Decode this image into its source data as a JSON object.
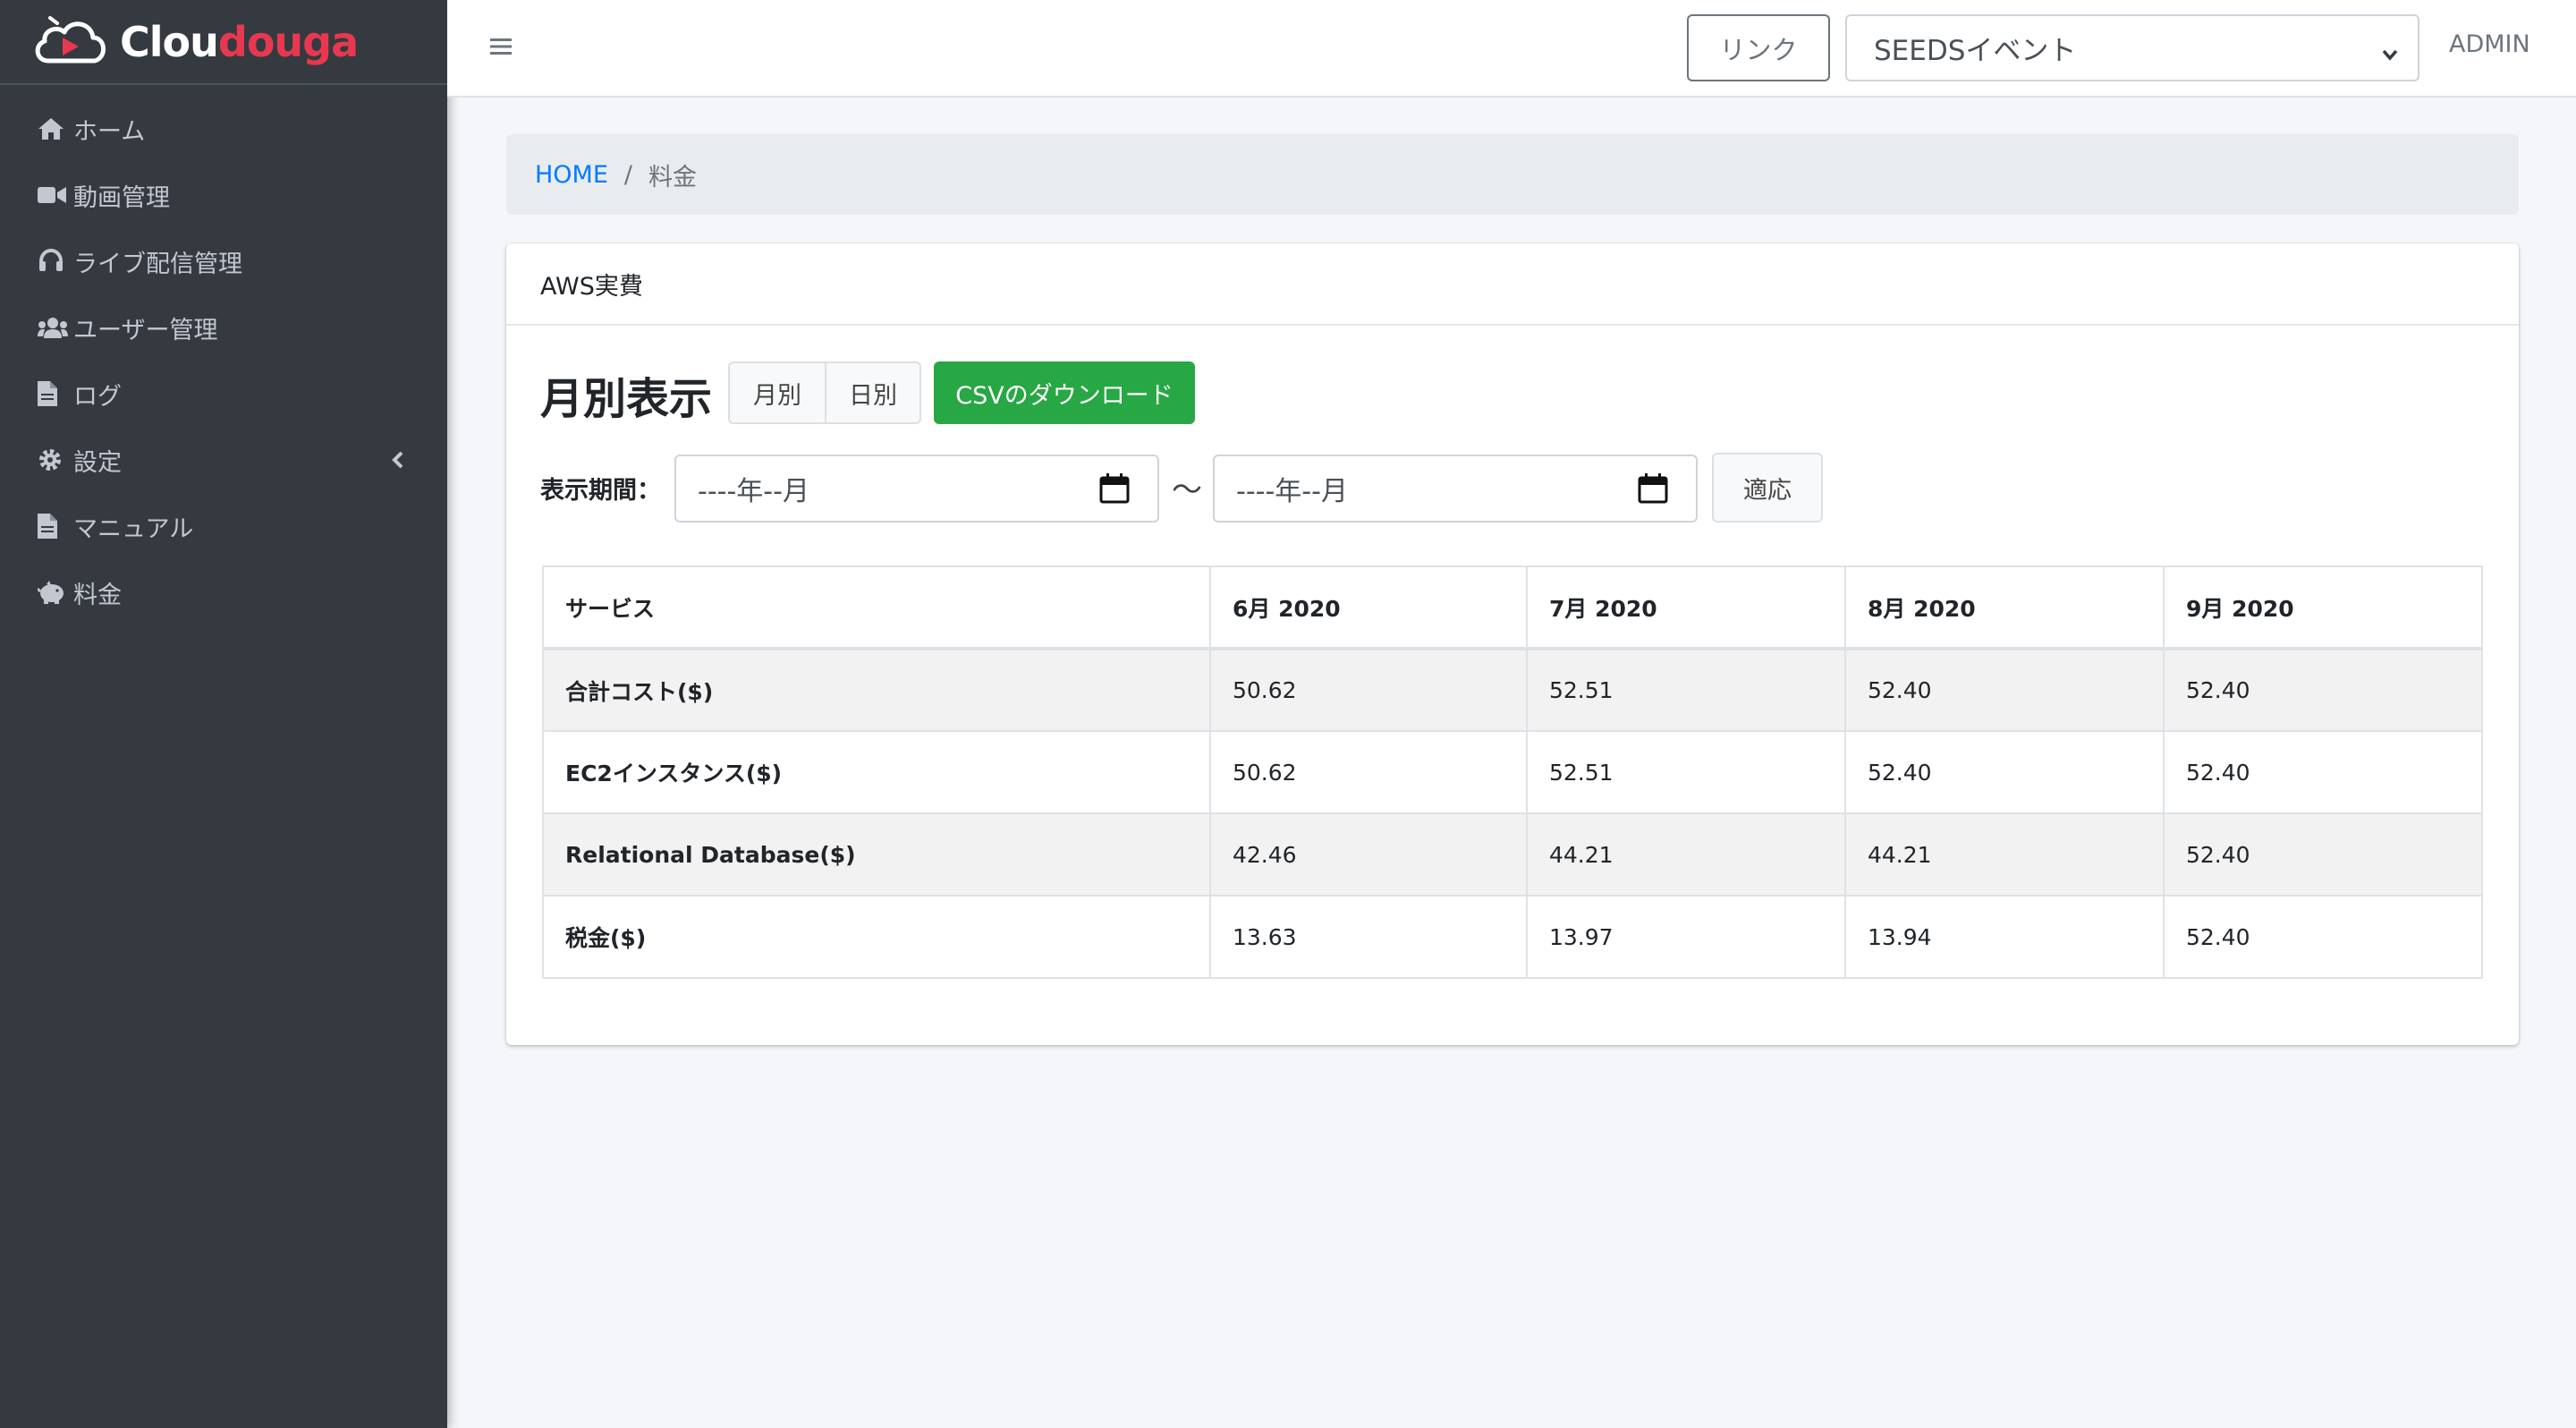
{
  "brand": {
    "part1": "Clou",
    "part2": "douga"
  },
  "sidebar": {
    "items": [
      {
        "icon": "home-icon",
        "label": "ホーム"
      },
      {
        "icon": "video-camera-icon",
        "label": "動画管理"
      },
      {
        "icon": "headset-icon",
        "label": "ライブ配信管理"
      },
      {
        "icon": "users-icon",
        "label": "ユーザー管理"
      },
      {
        "icon": "file-icon",
        "label": "ログ"
      },
      {
        "icon": "gear-icon",
        "label": "設定"
      },
      {
        "icon": "file-icon",
        "label": "マニュアル"
      },
      {
        "icon": "piggy-bank-icon",
        "label": "料金"
      }
    ]
  },
  "header": {
    "link_button": "リンク",
    "event_select": "SEEDSイベント",
    "user": "ADMIN"
  },
  "breadcrumb": {
    "home": "HOME",
    "separator": "/",
    "current": "料金"
  },
  "card": {
    "header": "AWS実費",
    "view_title": "月別表示",
    "toggle": {
      "monthly": "月別",
      "daily": "日別"
    },
    "csv_button": "CSVのダウンロード",
    "period_label": "表示期間：",
    "date_from_placeholder": "----年--月",
    "date_to_placeholder": "----年--月",
    "range_separator": "〜",
    "apply_button": "適応"
  },
  "table": {
    "headers": [
      "サービス",
      "6月 2020",
      "7月 2020",
      "8月 2020",
      "9月 2020"
    ],
    "rows": [
      {
        "service": "合計コスト($)",
        "values": [
          "50.62",
          "52.51",
          "52.40",
          "52.40"
        ]
      },
      {
        "service": "EC2インスタンス($)",
        "values": [
          "50.62",
          "52.51",
          "52.40",
          "52.40"
        ]
      },
      {
        "service": "Relational Database($)",
        "values": [
          "42.46",
          "44.21",
          "44.21",
          "52.40"
        ]
      },
      {
        "service": "税金($)",
        "values": [
          "13.63",
          "13.97",
          "13.94",
          "52.40"
        ]
      }
    ]
  },
  "colors": {
    "sidebar_bg": "#343a40",
    "accent_green": "#28a745",
    "link_blue": "#007bff",
    "brand_red": "#e8384f"
  }
}
